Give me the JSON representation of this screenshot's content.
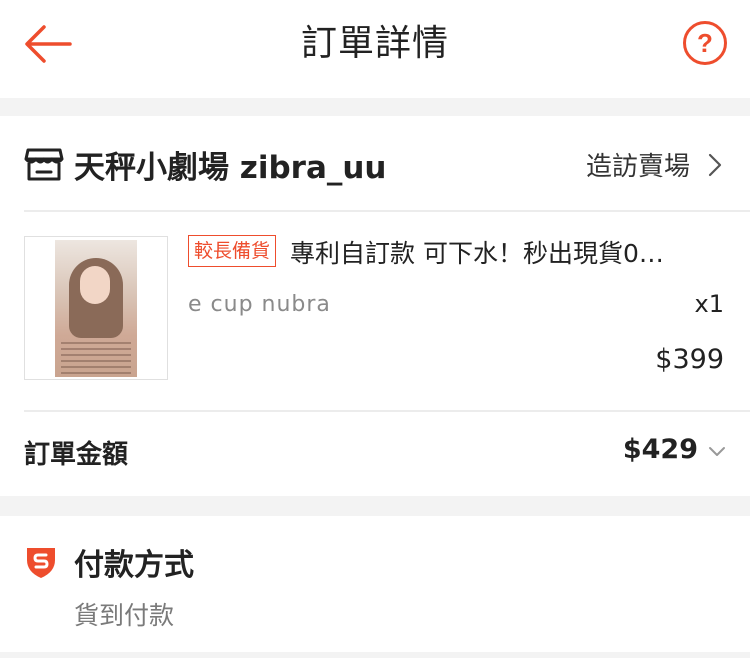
{
  "header": {
    "title": "訂單詳情",
    "back_icon": "arrow-left-icon",
    "help_icon": "question-circle-icon",
    "help_glyph": "?"
  },
  "shop": {
    "icon": "storefront-icon",
    "name": "天秤小劇場 zibra_uu",
    "visit_label": "造訪賣場"
  },
  "product": {
    "badge": "較長備貨",
    "title": "專利自訂款 可下水！秒出現貨0…",
    "variant": "e cup nubra",
    "quantity": "x1",
    "price": "$399"
  },
  "order_total": {
    "label": "訂單金額",
    "value": "$429"
  },
  "payment": {
    "icon": "shield-s-icon",
    "title": "付款方式",
    "method": "貨到付款"
  },
  "colors": {
    "accent": "#ee4d2d",
    "text": "#222222",
    "muted": "#8a8a8a",
    "background": "#f3f3f3"
  }
}
